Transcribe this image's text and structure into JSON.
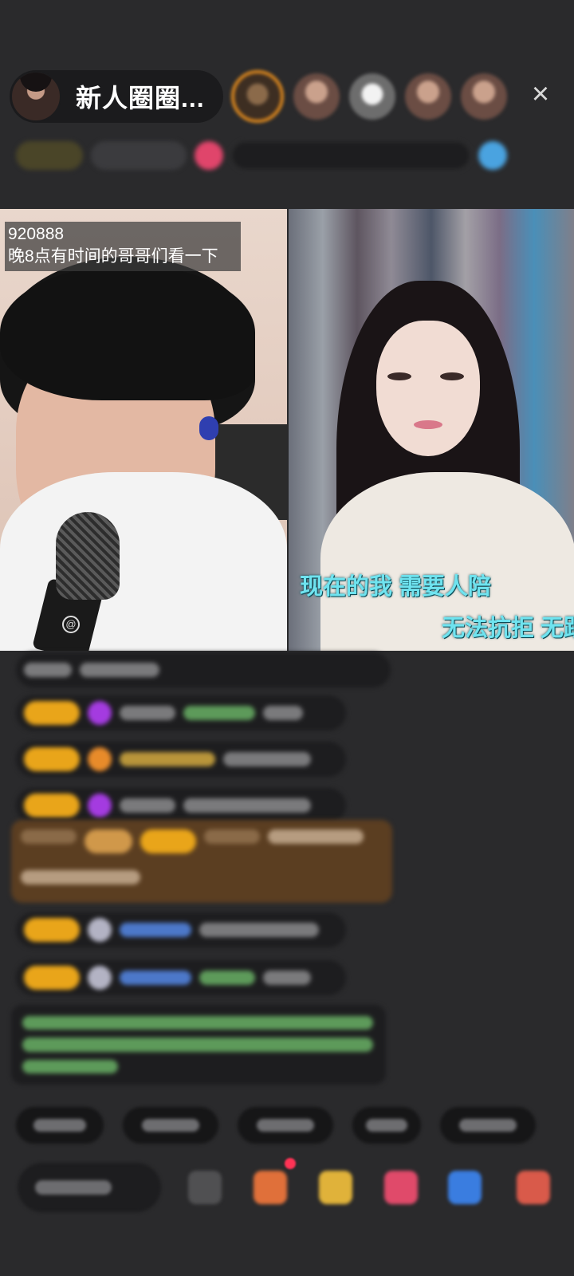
{
  "header": {
    "host_name": "新人圈圈...",
    "viewer_avatars": [
      "viewer-1",
      "viewer-2",
      "viewer-3",
      "viewer-4",
      "viewer-5"
    ],
    "close_icon": "×"
  },
  "left_stream": {
    "caption_line1": "920888",
    "caption_line2": "晚8点有时间的哥哥们看一下",
    "mic_logo": "@"
  },
  "right_stream": {
    "lyric_line1": "现在的我 需要人陪",
    "lyric_line2": "无法抗拒 无跟"
  },
  "colors": {
    "background": "#2a2a2c",
    "lyric": "#6fe3ef",
    "badge_gold": "#e9a51a",
    "gift_banner": "#5b3e21"
  },
  "icons": {
    "close": "close-icon",
    "emoji": "emoji-icon",
    "gift": "gift-icon",
    "more": "more-icon"
  }
}
